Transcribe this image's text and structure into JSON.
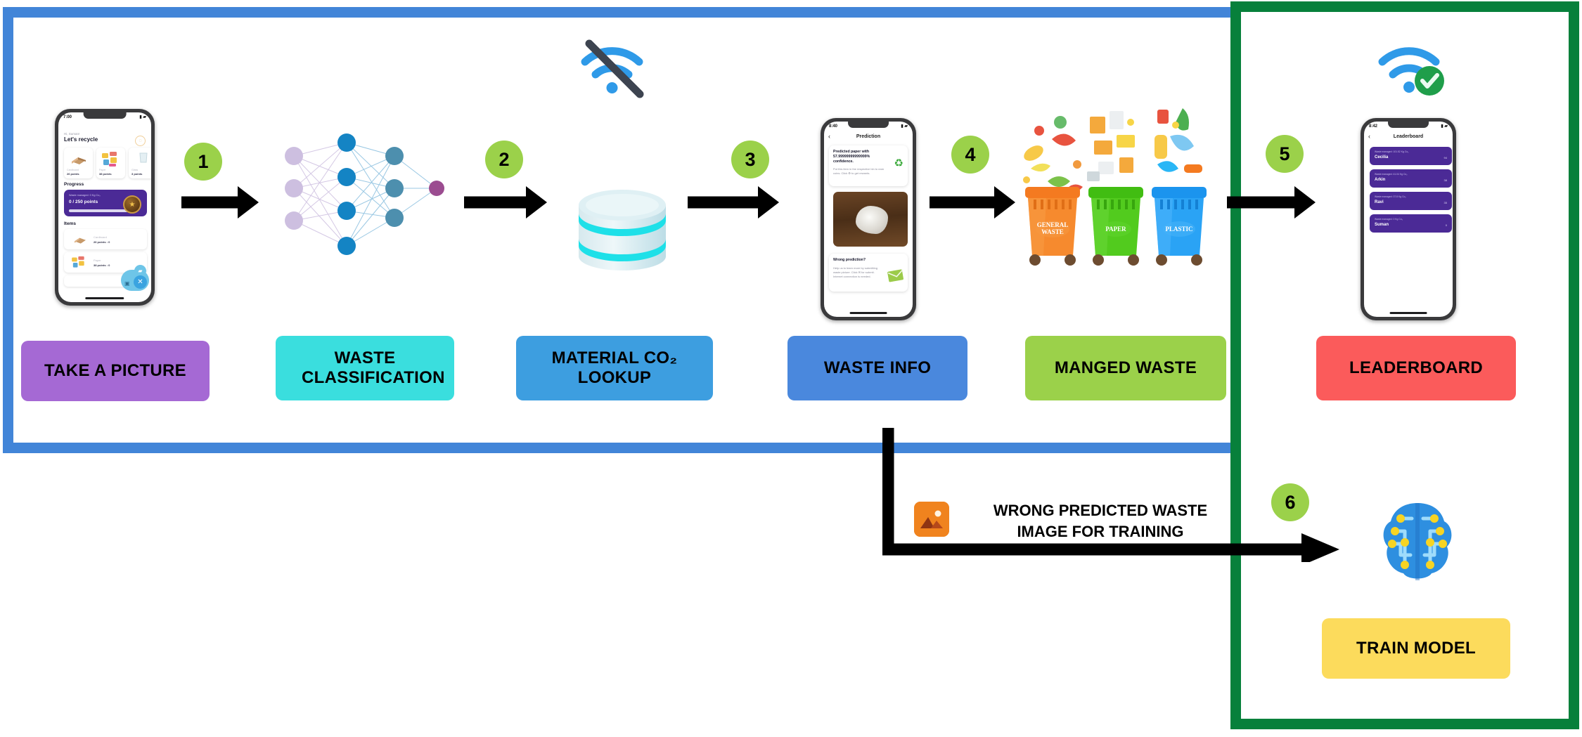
{
  "diagram": {
    "title": "Waste classification app pipeline",
    "frames": [
      {
        "name": "offline-section",
        "color": "#4285d8"
      },
      {
        "name": "online-section",
        "color": "#07803b"
      }
    ],
    "steps": [
      "1",
      "2",
      "3",
      "4",
      "5",
      "6"
    ],
    "stage_labels": [
      {
        "text": "TAKE A PICTURE",
        "color": "#a569d4"
      },
      {
        "text": "WASTE CLASSIFICATION",
        "color": "#3adede"
      },
      {
        "text": "MATERIAL CO₂ LOOKUP",
        "color": "#3d9ee0"
      },
      {
        "text": "WASTE   INFO",
        "color": "#4a88dd"
      },
      {
        "text": "MANGED  WASTE",
        "color": "#9bd14a"
      },
      {
        "text": "LEADERBOARD",
        "color": "#fb5b5b"
      },
      {
        "text": "TRAIN MODEL",
        "color": "#fcdb5c"
      }
    ],
    "feedback": {
      "text_line1": "WRONG PREDICTED WASTE",
      "text_line2": "IMAGE FOR TRAINING",
      "icon": "image-icon"
    },
    "icons": {
      "wifi_off": "wifi-off-icon",
      "wifi_connected": "wifi-connected-icon",
      "neural_network": "neural-network-icon",
      "database": "database-icon",
      "bins": "recycling-bins-icon",
      "brain": "ai-brain-icon"
    },
    "bins": [
      {
        "label": "GENERAL WASTE",
        "color": "#f47a20"
      },
      {
        "label": "PAPER",
        "color": "#4cc417"
      },
      {
        "label": "PLASTIC",
        "color": "#2196f3"
      }
    ]
  },
  "phone_home": {
    "time": "7:00",
    "greeting": "Hi, Suman!",
    "title": "Let's recycle",
    "bell": "🔔",
    "cards": [
      {
        "name": "Cardboard",
        "points": "26 points"
      },
      {
        "name": "Paper",
        "points": "38 points"
      },
      {
        "name": "Glass",
        "points": "3 points"
      }
    ],
    "progress_heading": "Progress",
    "progress_sub": "Waste managed: 0 Kg Co₂",
    "progress_value": "0 / 250 points",
    "items_heading": "Items",
    "items": [
      {
        "name": "Cardboard",
        "points": "26 points : 0"
      },
      {
        "name": "Paper",
        "points": "38 points : 0"
      }
    ]
  },
  "phone_prediction": {
    "time": "8:40",
    "back": "‹",
    "title": "Prediction",
    "headline": "Predicted paper with 57.99999999999999% confidence.",
    "body": "Put this item in the respective bin to earn coins. Click ♻ to get rewards.",
    "wrong_heading": "Wrong prediction?",
    "wrong_body": "Help us to learn more by submitting waste picture. Click ✉ for submit. Internet connection is needed."
  },
  "phone_leaderboard": {
    "time": "8:42",
    "back": "‹",
    "title": "Leaderboard",
    "rows": [
      {
        "sub": "Waste managed: 101.52 Kg Co₂",
        "name": "Cecilia",
        "score": "94"
      },
      {
        "sub": "Waste managed: 41.04 Kg Co₂",
        "name": "Arkin",
        "score": "38"
      },
      {
        "sub": "Waste managed: 37.8 Kg Co₂",
        "name": "Ravi",
        "score": "35"
      },
      {
        "sub": "Waste managed: 0 Kg Co₂",
        "name": "Suman",
        "score": "0"
      }
    ]
  }
}
